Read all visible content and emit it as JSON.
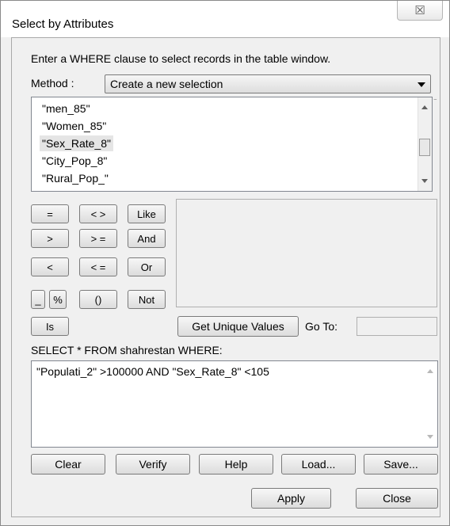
{
  "window": {
    "title": "Select by Attributes",
    "close_glyph": "☒"
  },
  "instruction": "Enter a WHERE clause to select records in the table window.",
  "method": {
    "label": "Method :",
    "value": "Create a new selection"
  },
  "fields": [
    "\"men_85\"",
    "\"Women_85\"",
    "\"Sex_Rate_8\"",
    "\"City_Pop_8\"",
    "\"Rural_Pop_\""
  ],
  "selected_field": "\"Sex_Rate_8\"",
  "operators": {
    "eq": "=",
    "ne": "< >",
    "like": "Like",
    "gt": ">",
    "ge": "> =",
    "and": "And",
    "lt": "<",
    "le": "< =",
    "or": "Or",
    "underscore": "_",
    "percent": "%",
    "parens": "()",
    "not": "Not",
    "is": "Is"
  },
  "get_unique_values": "Get Unique Values",
  "goto_label": "Go To:",
  "goto_value": "",
  "sql_prefix": "SELECT * FROM shahrestan WHERE:",
  "expression": "\"Populati_2\" >100000 AND \"Sex_Rate_8\" <105",
  "buttons": {
    "clear": "Clear",
    "verify": "Verify",
    "help": "Help",
    "load": "Load...",
    "save": "Save...",
    "apply": "Apply",
    "close": "Close"
  }
}
